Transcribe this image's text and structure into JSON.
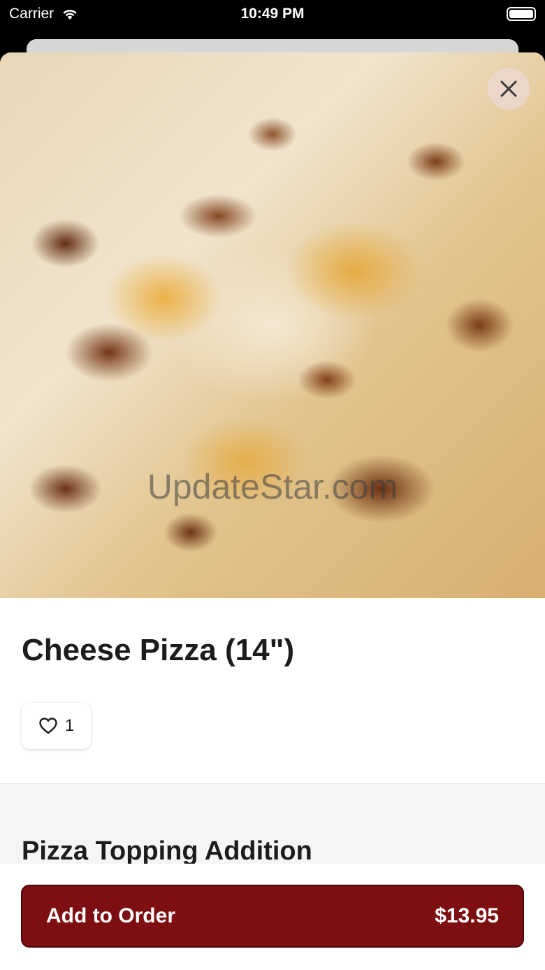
{
  "status_bar": {
    "carrier": "Carrier",
    "time": "10:49 PM"
  },
  "hero": {
    "watermark": "UpdateStar.com"
  },
  "item": {
    "title": "Cheese Pizza (14\")",
    "likes": "1"
  },
  "section": {
    "title": "Pizza Topping Addition"
  },
  "footer": {
    "button_label": "Add to Order",
    "price": "$13.95"
  },
  "colors": {
    "accent": "#7d0e11",
    "background": "#ffffff",
    "section_background": "#f5f5f5"
  }
}
